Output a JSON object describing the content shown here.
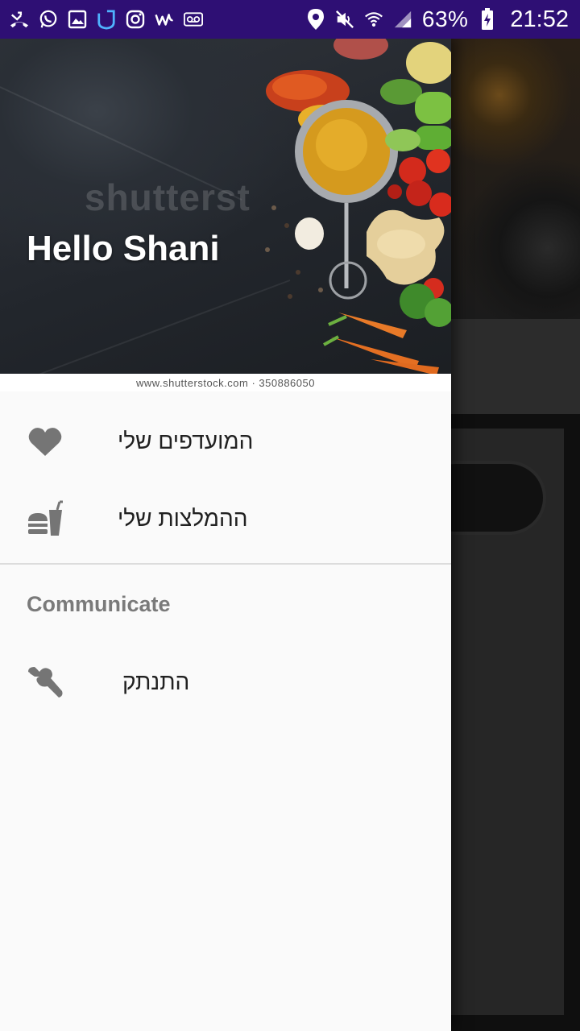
{
  "status_bar": {
    "left_icons": [
      "missed-call-icon",
      "whatsapp-icon",
      "gallery-icon",
      "shield-app-icon",
      "instagram-icon",
      "w-app-icon",
      "voicemail-icon"
    ],
    "right_icons": [
      "location-icon",
      "mute-icon",
      "wifi-icon",
      "signal-icon"
    ],
    "battery_percent": "63%",
    "time": "21:52"
  },
  "drawer": {
    "header": {
      "greeting": "Hello Shani",
      "watermark": "shutterst",
      "image_caption": "www.shutterstock.com · 350886050"
    },
    "items": [
      {
        "label": "המועדפים שלי",
        "icon": "heart-icon"
      },
      {
        "label": "ההמלצות שלי",
        "icon": "fastfood-icon"
      }
    ],
    "section_title": "Communicate",
    "section_items": [
      {
        "label": "התנתק",
        "icon": "wrench-icon"
      }
    ]
  },
  "colors": {
    "status_bar": "#2e0f74",
    "drawer_bg": "#fafafa",
    "icon_gray": "#757575",
    "text_dark": "#212121",
    "section_gray": "#7a7a7a"
  }
}
